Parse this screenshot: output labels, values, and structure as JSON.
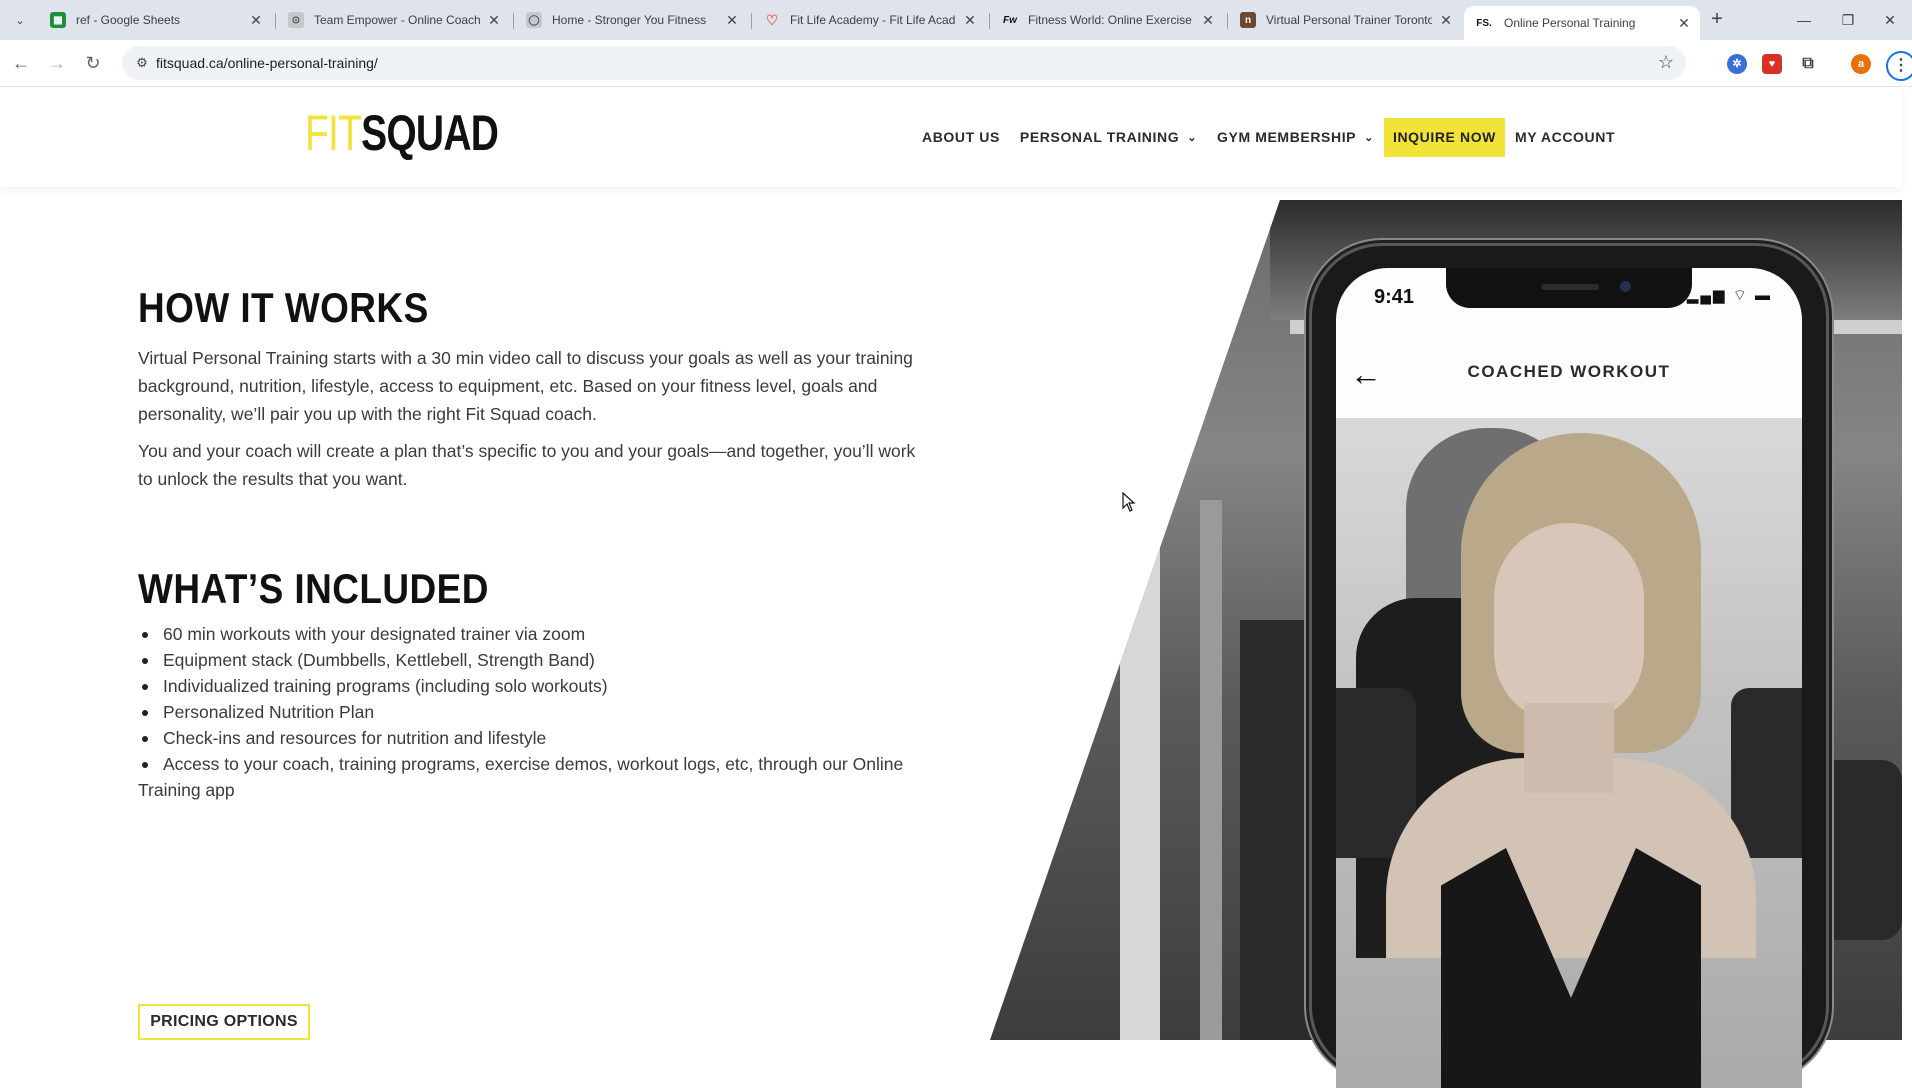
{
  "browser": {
    "tabs": [
      {
        "title": "ref - Google Sheets",
        "favicon": "sheets-favicon",
        "color": "#1e8e3e",
        "glyph": "▦"
      },
      {
        "title": "Team Empower - Online Coachi",
        "favicon": "team-empower-favicon",
        "color": "#9aa0a6",
        "glyph": "⊙"
      },
      {
        "title": "Home - Stronger You Fitness",
        "favicon": "globe-favicon",
        "color": "#9aa0a6",
        "glyph": "◯"
      },
      {
        "title": "Fit Life Academy - Fit Life Acad",
        "favicon": "fit-life-favicon",
        "color": "#e86a5c",
        "glyph": "♡"
      },
      {
        "title": "Fitness World: Online Exercise C",
        "favicon": "fitness-world-favicon",
        "color": "#111111",
        "glyph": "Fw"
      },
      {
        "title": "Virtual Personal Trainer Toronto",
        "favicon": "virtual-trainer-favicon",
        "color": "#6b4a2e",
        "glyph": "n"
      },
      {
        "title": "Online Personal Training",
        "favicon": "fitsquad-favicon",
        "color": "#111111",
        "glyph": "FS."
      }
    ],
    "address": "fitsquad.ca/online-personal-training/",
    "profile_initial": "a"
  },
  "header": {
    "logo_fit": "FIT",
    "logo_squad": "SQUAD",
    "nav": {
      "about": "ABOUT US",
      "personal_training": "PERSONAL TRAINING",
      "gym_membership": "GYM MEMBERSHIP",
      "inquire": "INQUIRE NOW",
      "account": "MY ACCOUNT"
    }
  },
  "how_it_works": {
    "title": "HOW IT WORKS",
    "para1": "Virtual Personal Training starts with a 30 min video call to discuss your goals as well as your training background, nutrition, lifestyle, access to equipment, etc. Based on your fitness level, goals and personality, we’ll pair you up with the right Fit Squad coach.",
    "para2": "You and your coach will create a plan that’s specific to you and your goals—and together, you’ll work to unlock the results that you want."
  },
  "whats_included": {
    "title": "WHAT’S INCLUDED",
    "items": [
      "60 min workouts with your designated trainer via zoom",
      "Equipment stack (Dumbbells, Kettlebell, Strength Band)",
      "Individualized training programs (including solo workouts)",
      "Personalized Nutrition Plan",
      "Check-ins and resources for nutrition and lifestyle",
      "Access to your coach, training programs, exercise demos, workout logs, etc, through our Online Training app"
    ]
  },
  "pricing_button": "PRICING OPTIONS",
  "phone": {
    "time": "9:41",
    "screen_title": "COACHED WORKOUT"
  },
  "colors": {
    "brand_yellow": "#f2e339",
    "text_dark": "#111111"
  }
}
